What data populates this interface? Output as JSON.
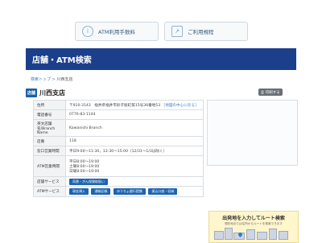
{
  "top_buttons": {
    "atm_fee": "ATM利用手数料",
    "information": "ご利用規程"
  },
  "header": {
    "title": "店舗・ATM検索"
  },
  "breadcrumb": {
    "home": "検索トップ",
    "separator": ">",
    "current": "川西支店"
  },
  "branch": {
    "icon_label": "店舗",
    "name": "川西支店"
  },
  "print_button": "印刷する",
  "info": {
    "address_label": "住所",
    "address": "〒910-3143　福井県福井市砂子坂町第15号36番地53",
    "map_link": "［地図の中心に戻る］",
    "phone_label": "電話番号",
    "phone": "0776-83-1144",
    "english_label": "英文店舗名/Branch Name",
    "english": "Kawanishi Branch",
    "number_label": "店番",
    "number": "118",
    "hours_label": "窓口営業時間",
    "hours": "平日9:00～11:30，12:30～15:00（12/31～1/3は除く）",
    "atm_hours_label": "ATM営業時間",
    "atm_hours": [
      "平日8:00～19:00",
      "土曜8:00～19:00",
      "日曜8:00～19:00"
    ],
    "services_label": "店舗サービス",
    "services": [
      "両替・がん保険取扱い"
    ],
    "atm_services_label": "ATMサービス",
    "atm_services": [
      "現金預入",
      "通帳記帳",
      "ゆうちょ銀行提携",
      "振込口座・収納"
    ]
  },
  "route": {
    "title": "出発地を入力してルート検索",
    "subtitle": "現在地または住所からルートを検索できます"
  }
}
